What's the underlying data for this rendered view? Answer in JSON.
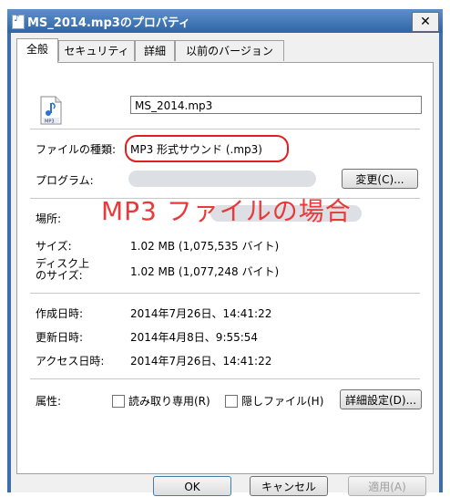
{
  "window": {
    "title": "MS_2014.mp3のプロパティ",
    "close_label": "✕"
  },
  "tabs": [
    {
      "label": "全般",
      "active": true
    },
    {
      "label": "セキュリティ",
      "active": false
    },
    {
      "label": "詳細",
      "active": false
    },
    {
      "label": "以前のバージョン",
      "active": false
    }
  ],
  "general": {
    "file_name": "MS_2014.mp3",
    "file_type_label": "ファイルの種類:",
    "file_type_value": "MP3 形式サウンド (.mp3)",
    "program_label": "プログラム:",
    "change_button": "変更(C)...",
    "location_label": "場所:",
    "size_label": "サイズ:",
    "size_value": "1.02 MB (1,075,535 バイト)",
    "disk_size_label_line1": "ディスク上",
    "disk_size_label_line2": "のサイズ:",
    "disk_size_value": "1.02 MB (1,077,248 バイト)",
    "created_label": "作成日時:",
    "created_value": "2014年7月26日、14:41:22",
    "modified_label": "更新日時:",
    "modified_value": "2014年4月8日、9:55:54",
    "accessed_label": "アクセス日時:",
    "accessed_value": "2014年7月26日、14:41:22",
    "attributes_label": "属性:",
    "readonly_label": "読み取り専用(R)",
    "hidden_label": "隠しファイル(H)",
    "advanced_button": "詳細設定(D)..."
  },
  "annotation": {
    "overlay_text": "MP3 ファイルの場合",
    "color": "#e83a3a"
  },
  "footer": {
    "ok": "OK",
    "cancel": "キャンセル",
    "apply": "適用(A)"
  },
  "icons": {
    "file_icon": "mp3-file-icon",
    "title_icon": "mp3-file-icon"
  }
}
